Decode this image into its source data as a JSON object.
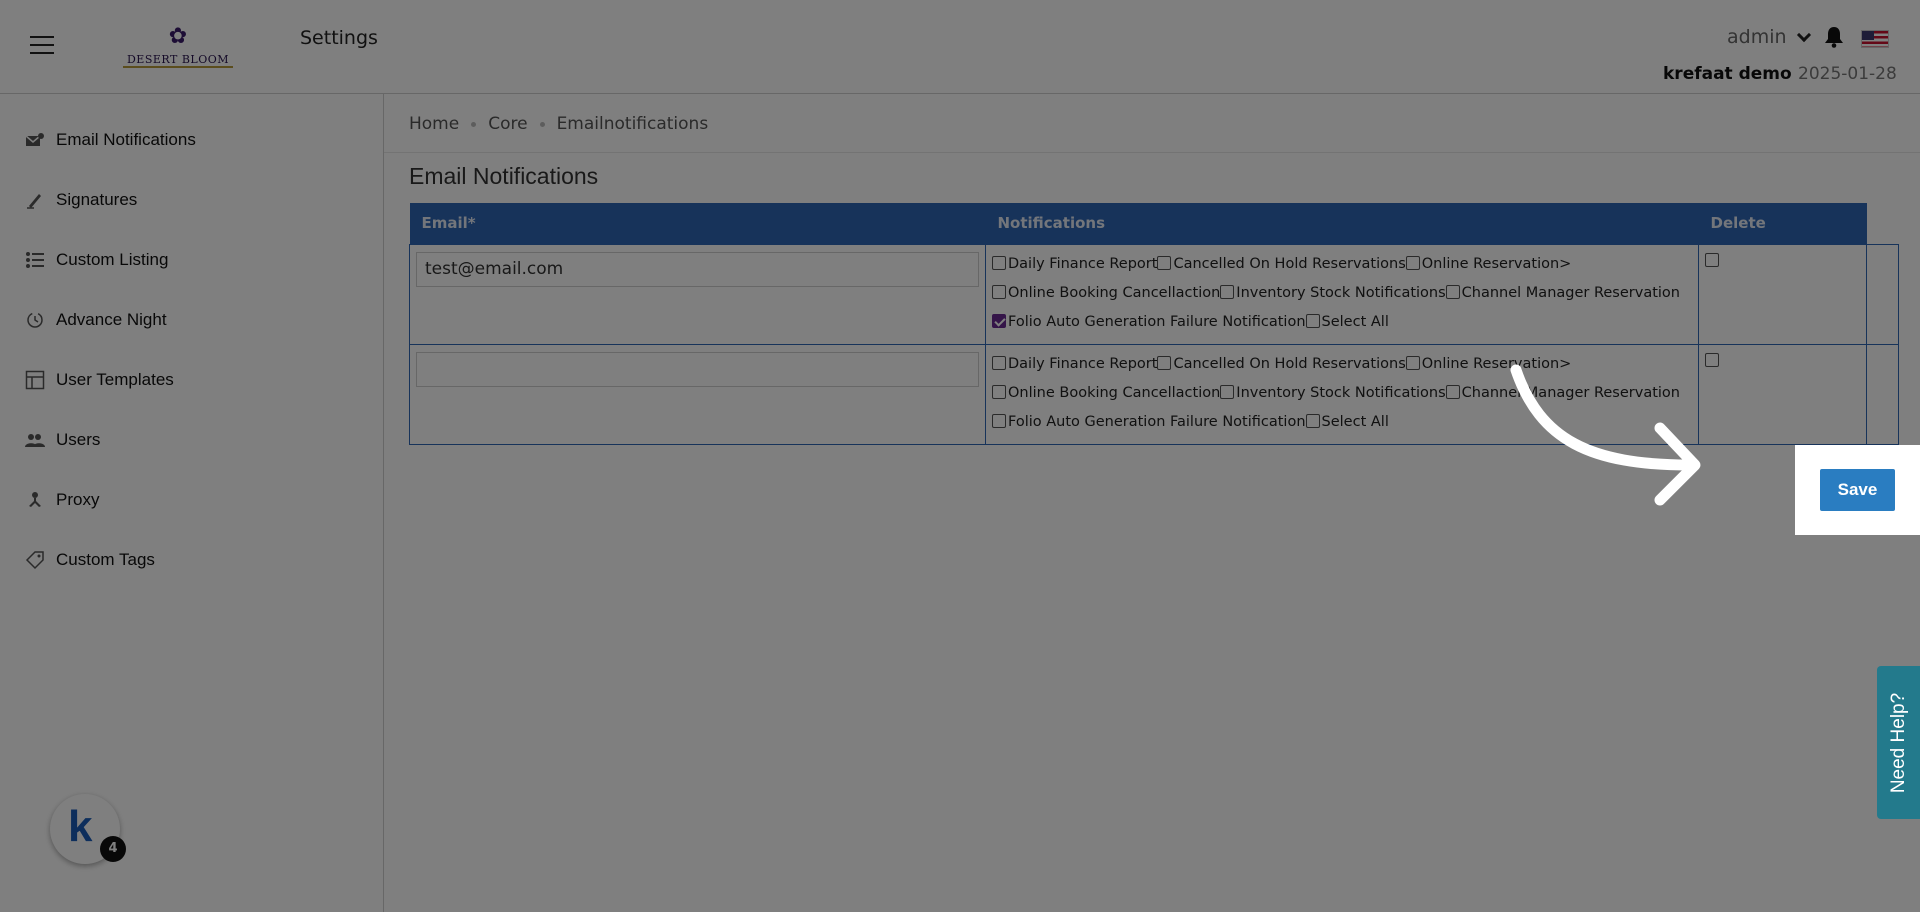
{
  "header": {
    "title": "Settings",
    "logo_text": "DESERT BLOOM",
    "user_menu": "admin",
    "user_name": "krefaat demo",
    "date": "2025-01-28"
  },
  "sidebar": {
    "items": [
      {
        "label": "Email Notifications",
        "icon": "email-notification-icon"
      },
      {
        "label": "Signatures",
        "icon": "signature-icon"
      },
      {
        "label": "Custom Listing",
        "icon": "list-icon"
      },
      {
        "label": "Advance Night",
        "icon": "clock-icon"
      },
      {
        "label": "User Templates",
        "icon": "template-icon"
      },
      {
        "label": "Users",
        "icon": "users-icon"
      },
      {
        "label": "Proxy",
        "icon": "proxy-icon"
      },
      {
        "label": "Custom Tags",
        "icon": "tag-icon"
      }
    ],
    "badge_count": "4"
  },
  "breadcrumb": [
    "Home",
    "Core",
    "Emailnotifications"
  ],
  "page_title": "Email Notifications",
  "table": {
    "headers": {
      "email": "Email*",
      "notifications": "Notifications",
      "delete": "Delete"
    },
    "rows": [
      {
        "email": "test@email.com",
        "notifications": {
          "daily_finance_report": {
            "label": "Daily Finance Report",
            "checked": false
          },
          "cancelled_on_hold": {
            "label": "Cancelled On Hold Reservations",
            "checked": false
          },
          "online_reservation": {
            "label": "Online Reservation>",
            "checked": false
          },
          "online_booking_cancellation": {
            "label": "Online Booking Cancellaction",
            "checked": false
          },
          "inventory_stock": {
            "label": "Inventory Stock Notifications",
            "checked": false
          },
          "channel_manager": {
            "label": "Channel Manager Reservation",
            "checked": false
          },
          "folio_auto_generation": {
            "label": "Folio Auto Generation Failure Notification",
            "checked": true
          },
          "select_all": {
            "label": "Select All",
            "checked": false
          }
        },
        "delete": false
      },
      {
        "email": "",
        "notifications": {
          "daily_finance_report": {
            "label": "Daily Finance Report",
            "checked": false
          },
          "cancelled_on_hold": {
            "label": "Cancelled On Hold Reservations",
            "checked": false
          },
          "online_reservation": {
            "label": "Online Reservation>",
            "checked": false
          },
          "online_booking_cancellation": {
            "label": "Online Booking Cancellaction",
            "checked": false
          },
          "inventory_stock": {
            "label": "Inventory Stock Notifications",
            "checked": false
          },
          "channel_manager": {
            "label": "Channel Manager Reservation",
            "checked": false
          },
          "folio_auto_generation": {
            "label": "Folio Auto Generation Failure Notification",
            "checked": false
          },
          "select_all": {
            "label": "Select All",
            "checked": false
          }
        },
        "delete": false
      }
    ]
  },
  "save_label": "Save",
  "need_help": "Need Help?",
  "colors": {
    "table_header": "#2f67b5",
    "save_button": "#2a7dc1",
    "checkbox_checked": "#6a2a93",
    "need_help": "#237a8c"
  }
}
